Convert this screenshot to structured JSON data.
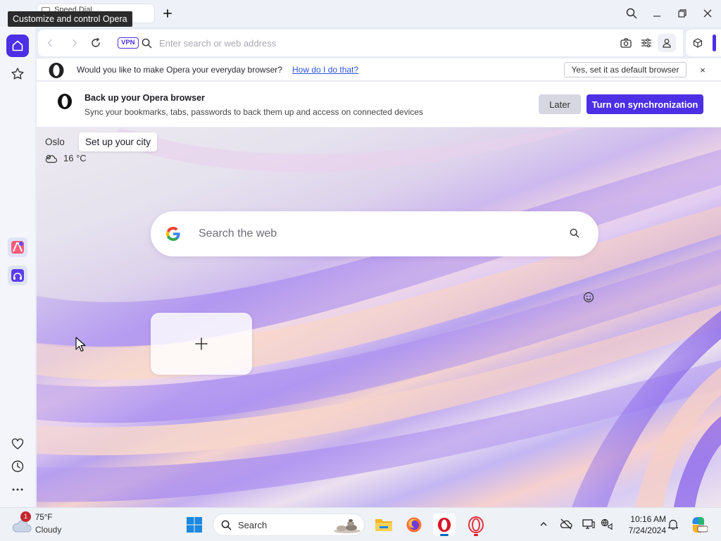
{
  "titlebar": {
    "tab_title": "Speed Dial",
    "tooltip": "Customize and control Opera"
  },
  "addressbar": {
    "vpn_label": "VPN",
    "placeholder": "Enter search or web address"
  },
  "default_bar": {
    "question": "Would you like to make Opera your everyday browser?",
    "link": "How do I do that?",
    "button": "Yes, set it as default browser",
    "close": "×"
  },
  "sync_bar": {
    "title": "Back up your Opera browser",
    "description": "Sync your bookmarks, tabs, passwords to back them up and access on connected devices",
    "later_label": "Later",
    "sync_label": "Turn on synchronization"
  },
  "start_page": {
    "city": "Oslo",
    "city_tip": "Set up your city",
    "temperature": "16 °C",
    "search_placeholder": "Search the web"
  },
  "taskbar": {
    "weather_badge": "1",
    "weather_temp": "75°F",
    "weather_condition": "Cloudy",
    "search_label": "Search",
    "time": "10:16 AM",
    "date": "7/24/2024"
  },
  "colors": {
    "accent": "#4d2fe5",
    "opera_red": "#d31a2a",
    "link": "#2d55d8"
  },
  "icons": {
    "sidebar": [
      "home-icon",
      "star-icon",
      "aria-app-icon",
      "music-app-icon",
      "heart-icon",
      "clock-icon",
      "more-icon"
    ],
    "addressbar": [
      "back-icon",
      "forward-icon",
      "reload-icon",
      "search-icon",
      "camera-icon",
      "easy-setup-icon",
      "profile-icon",
      "extensions-icon"
    ]
  }
}
